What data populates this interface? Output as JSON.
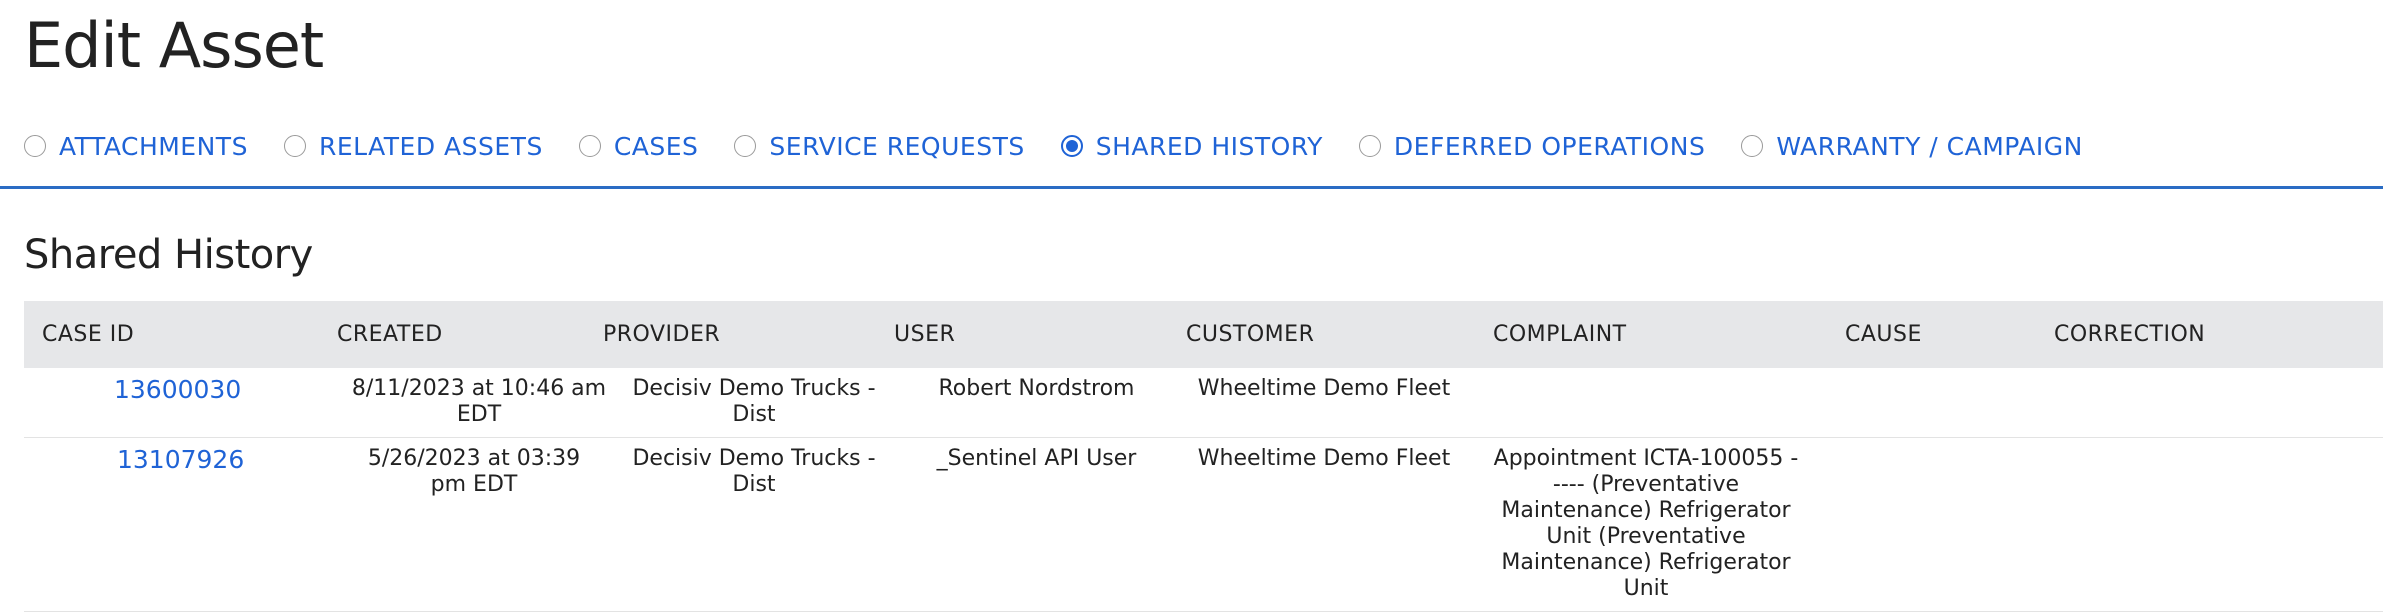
{
  "page": {
    "title": "Edit Asset"
  },
  "tabs": [
    {
      "label": "ATTACHMENTS",
      "selected": false
    },
    {
      "label": "RELATED ASSETS",
      "selected": false
    },
    {
      "label": "CASES",
      "selected": false
    },
    {
      "label": "SERVICE REQUESTS",
      "selected": false
    },
    {
      "label": "SHARED HISTORY",
      "selected": true
    },
    {
      "label": "DEFERRED OPERATIONS",
      "selected": false
    },
    {
      "label": "WARRANTY / CAMPAIGN",
      "selected": false
    }
  ],
  "section": {
    "title": "Shared History"
  },
  "table": {
    "columns": [
      "CASE ID",
      "CREATED",
      "PROVIDER",
      "USER",
      "CUSTOMER",
      "COMPLAINT",
      "CAUSE",
      "CORRECTION"
    ],
    "rows": [
      {
        "case_id": "13600030",
        "created": "8/11/2023 at 10:46 am EDT",
        "provider": "Decisiv Demo Trucks - Dist",
        "user": "Robert Nordstrom",
        "customer": "Wheeltime Demo Fleet",
        "complaint": "",
        "cause": "",
        "correction": ""
      },
      {
        "case_id": "13107926",
        "created": "5/26/2023 at 03:39 pm EDT",
        "provider": "Decisiv Demo Trucks - Dist",
        "user": "_Sentinel API User",
        "customer": "Wheeltime Demo Fleet",
        "complaint": "Appointment ICTA-100055 ----- (Preventative Maintenance) Refrigerator Unit (Preventative Maintenance) Refrigerator Unit",
        "cause": "",
        "correction": ""
      }
    ]
  },
  "colors": {
    "accent": "#1f63d6",
    "divider": "#2a6cc4",
    "header_bg": "#e6e7e9"
  }
}
